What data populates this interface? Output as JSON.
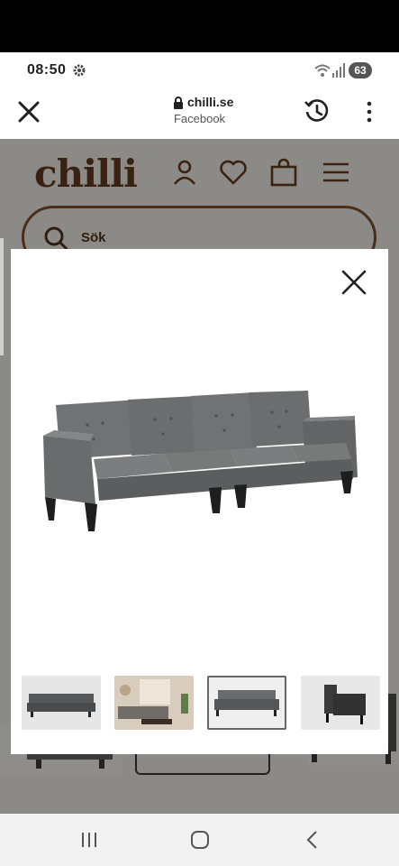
{
  "status_bar": {
    "time": "08:50",
    "battery": "63",
    "icons": [
      "gear-icon",
      "wifi-icon",
      "signal-icon"
    ]
  },
  "browser": {
    "domain": "chilli.se",
    "source": "Facebook",
    "icons": [
      "close-icon",
      "lock-icon",
      "history-icon",
      "more-icon"
    ]
  },
  "site": {
    "logo": "chilli",
    "search_placeholder": "Sök",
    "header_icons": [
      "user-icon",
      "heart-icon",
      "bag-icon",
      "menu-icon"
    ],
    "brand_color": "#3a2212"
  },
  "gallery": {
    "product": "grey four-seat fabric sofa",
    "selected_index": 3,
    "thumbnails": [
      {
        "name": "sofa-side-view"
      },
      {
        "name": "sofa-living-room"
      },
      {
        "name": "sofa-front-view"
      },
      {
        "name": "sofa-end-view"
      }
    ]
  },
  "nav_bar": {
    "icons": [
      "recents-icon",
      "home-icon",
      "back-icon"
    ]
  }
}
